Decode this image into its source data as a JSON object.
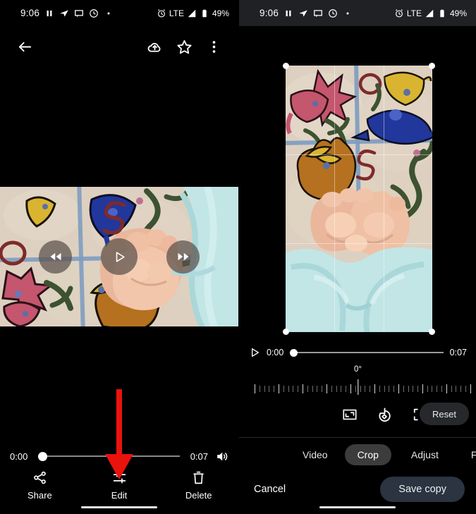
{
  "status_bar": {
    "time": "9:06",
    "left_icons": [
      "pause-icon",
      "send-icon",
      "message-icon",
      "history-icon",
      "dot-icon"
    ],
    "right_icons": [
      "alarm-icon",
      "signal-icon",
      "battery-icon"
    ],
    "network": "LTE",
    "battery": "49%"
  },
  "left_panel": {
    "app_bar": {
      "back": "back-arrow-icon",
      "backup": "cloud-upload-icon",
      "favorite": "star-icon",
      "overflow": "more-vert-icon"
    },
    "video_controls": {
      "rewind": "rewind-icon",
      "play": "play-icon",
      "forward": "fast-forward-icon"
    },
    "timeline": {
      "current_time": "0:00",
      "total_time": "0:07",
      "volume_icon": "volume-up-icon",
      "progress_percent": 0
    },
    "actions": [
      {
        "label": "Share",
        "icon": "share-icon"
      },
      {
        "label": "Edit",
        "icon": "tune-icon"
      },
      {
        "label": "Delete",
        "icon": "trash-icon"
      }
    ]
  },
  "right_panel": {
    "playbar": {
      "play_icon": "play-icon",
      "current_time": "0:00",
      "total_time": "0:07",
      "progress_percent": 0
    },
    "rotation": {
      "value_label": "0°",
      "degrees": 0
    },
    "crop_tools": [
      {
        "name": "aspect-ratio",
        "icon": "aspect-ratio-icon"
      },
      {
        "name": "rotate",
        "icon": "rotate-left-icon"
      },
      {
        "name": "expand",
        "icon": "expand-icon"
      }
    ],
    "reset_label": "Reset",
    "tabs": [
      {
        "label": "Video",
        "active": false
      },
      {
        "label": "Crop",
        "active": true
      },
      {
        "label": "Adjust",
        "active": false
      },
      {
        "label": "Filters",
        "active": false
      }
    ],
    "cancel_label": "Cancel",
    "save_label": "Save copy"
  },
  "colors": {
    "background": "#000000",
    "statusbar_tint": "#202124",
    "accent_arrow": "#e8130c",
    "active_tab": "#3c3c3c",
    "save_button": "#2b3440",
    "reset_button": "#27282b"
  }
}
